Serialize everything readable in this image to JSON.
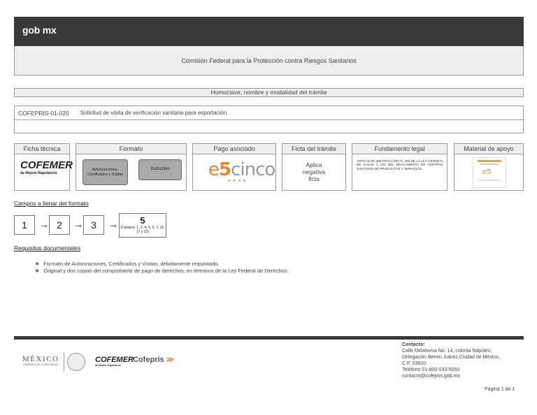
{
  "header": {
    "logo": "gob mx",
    "agency": "Comisión Federal para la Protección contra Riesgos Sanitarios"
  },
  "homoclave_title": "Homoclave, nombre y modalidad del trámite",
  "tramite": {
    "code": "COFEPRIS-01-020",
    "name": "Solicitud de visita de verificación sanitaria para exportación."
  },
  "columns": {
    "ficha": "Ficha técnica",
    "formato": "Formato",
    "pago": "Pago asociado",
    "ficta": "Ficta del trámite",
    "fundamento": "Fundamento legal",
    "material": "Material de apoyo"
  },
  "ficha_logo": {
    "main": "COFEMER",
    "sub": "de Mejora Regulatoria"
  },
  "formato_buttons": {
    "autorizaciones": "Autorizaciones, Certificados y Visitas",
    "instructivo": "Instructivo"
  },
  "pago_logo": {
    "e": "e",
    "five": "5",
    "cinco": "cinco"
  },
  "ficta_text": [
    "Aplica",
    "negativa",
    "ficta"
  ],
  "fundamento_text": "ARTÍCULOS 389 FRACCIÓN IV, 392 DE LA LEY GENERAL DE SALUD Y 242 DEL REGLAMENTO DE CONTROL SANITARIO DE PRODUCTOS Y SERVICIOS.",
  "campos_title": "Campos a llenar del formato",
  "steps": [
    "1",
    "2",
    "3"
  ],
  "arrow": "→",
  "step5": {
    "number": "5",
    "sub": "(Campos: 1, 2, 4, 5, 6, 7, 15, 17 y 22)"
  },
  "requisitos_title": "Requisitos documentales",
  "bullet": "❖",
  "requisitos": [
    "Formato de Autorizaciones, Certificados y Visitas, debidamente requisitado.",
    "Original y dos copias del comprobante de pago de derechos, en términos de la Ley Federal de Derechos."
  ],
  "footer": {
    "mexico": "MÉXICO",
    "gobierno": "GOBIERNO DE LA REPÚBLICA",
    "cofemer": "COFEMER",
    "cofepris": "Cofepris",
    "contact_title": "Contacto:",
    "contact_lines": [
      "Calle Oklahoma No. 14, colonia Nápoles;",
      "Delegación Benito Juárez,Ciudad de México,",
      "C.P. 03810.",
      "Teléfono 01-800-033-5050",
      "contacto@cofepris.gob.mx"
    ],
    "page": "Página 1 de 1"
  }
}
